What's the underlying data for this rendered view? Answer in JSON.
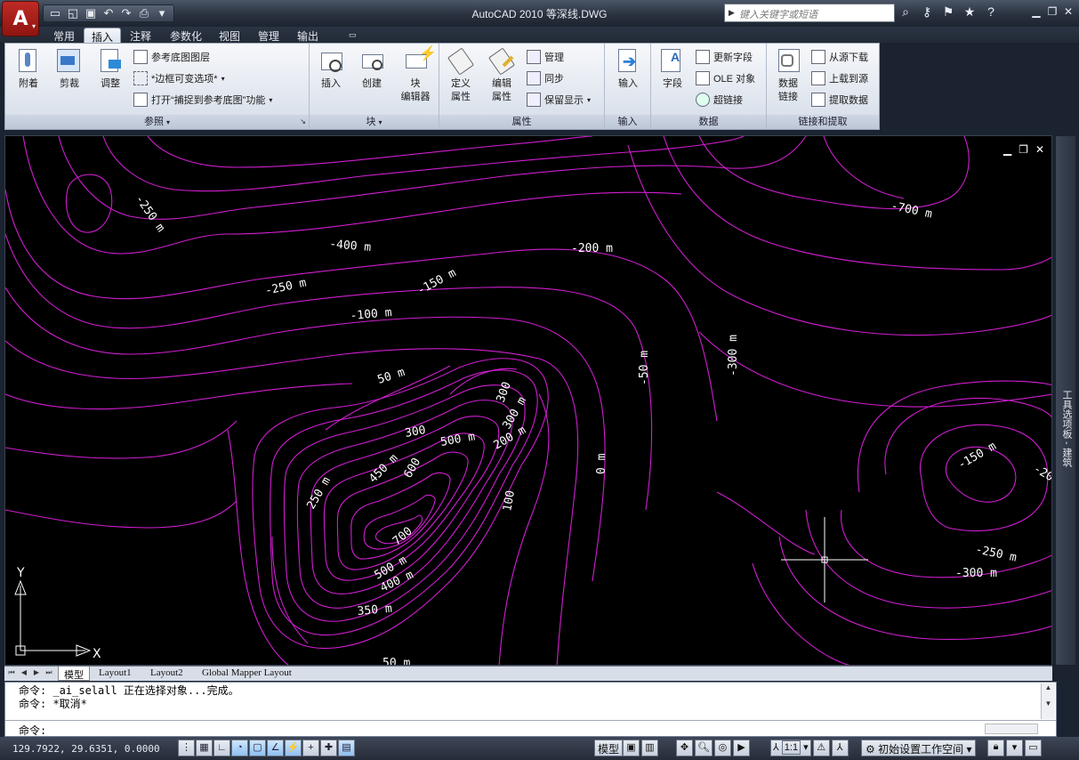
{
  "window": {
    "title": "AutoCAD 2010    等深线.DWG",
    "search_placeholder": "键入关键字或短语"
  },
  "app_button": {
    "logo": "A",
    "dropdown": "▾"
  },
  "quick_access": [
    {
      "name": "new-icon",
      "glyph": "▭"
    },
    {
      "name": "open-icon",
      "glyph": "📂"
    },
    {
      "name": "save-icon",
      "glyph": "💾"
    },
    {
      "name": "undo-icon",
      "glyph": "↶"
    },
    {
      "name": "redo-icon",
      "glyph": "↷"
    },
    {
      "name": "plot-icon",
      "glyph": "🖶"
    }
  ],
  "ribbon_tabs": [
    "常用",
    "插入",
    "注释",
    "参数化",
    "视图",
    "管理",
    "输出"
  ],
  "active_tab": "插入",
  "ribbon": {
    "reference": {
      "footer": "参照",
      "attach": "附着",
      "clip": "剪裁",
      "adjust": "调整",
      "underlay_layers": "参考底图图层",
      "frames_variable": "*边框可变选项*",
      "snap_underlay": "打开“捕捉到参考底图”功能"
    },
    "block": {
      "footer": "块",
      "insert": "插入",
      "create": "创建",
      "editor": "块\n编辑器"
    },
    "attributes": {
      "footer": "属性",
      "define": "定义\n属性",
      "edit": "编辑\n属性",
      "manage": "管理",
      "sync": "同步",
      "retain": "保留显示"
    },
    "import": {
      "footer": "输入",
      "import": "输入"
    },
    "data": {
      "footer": "数据",
      "field": "字段",
      "update_fields": "更新字段",
      "ole": "OLE 对象",
      "hyperlink": "超链接"
    },
    "link": {
      "footer": "链接和提取",
      "data_link": "数据\n链接",
      "download": "从源下载",
      "upload": "上载到源",
      "extract": "提取数据"
    }
  },
  "contour_labels": [
    "-250 m",
    "-400 m",
    "-200 m",
    "-700 m",
    "-250 m",
    "-150 m",
    "-100 m",
    "-50 m",
    "-300 m",
    "50 m",
    "300",
    "300 m",
    "300",
    "500 m",
    "200 m",
    "450 m",
    "600",
    "250 m",
    "0 m",
    "100",
    "700",
    "500 m",
    "400 m",
    "350 m",
    "-150 m",
    "-20",
    "-250 m",
    "-300 m",
    "50 m"
  ],
  "ucs": {
    "x": "X",
    "y": "Y"
  },
  "layout_tabs": [
    "模型",
    "Layout1",
    "Layout2",
    "Global Mapper Layout"
  ],
  "command": {
    "history_1": "命令: _ai_selall 正在选择对象...完成。",
    "history_2": "命令: *取消*",
    "prompt": "命令:"
  },
  "status": {
    "coords": "129.7922, 29.6351, 0.0000",
    "model": "模型",
    "scale": "1:1",
    "workspace": "初始设置工作空间"
  },
  "tool_palette_label": "工具选项板 - 建筑",
  "colors": {
    "contour": "#d01ed0",
    "background": "#000000",
    "label": "#ffffff"
  }
}
